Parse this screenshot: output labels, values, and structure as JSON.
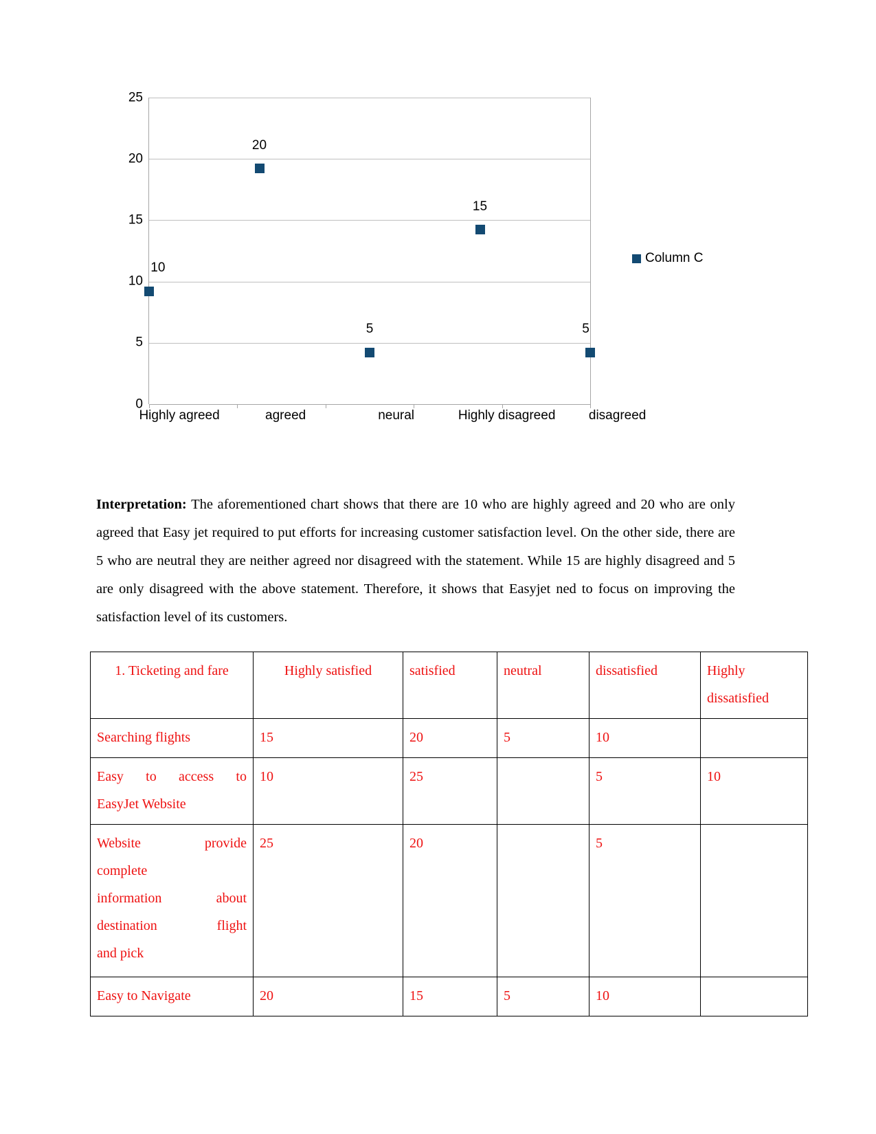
{
  "chart_data": {
    "type": "scatter",
    "title": "",
    "xlabel": "",
    "ylabel": "",
    "categories": [
      "Highly agreed",
      "agreed",
      "neural",
      "Highly disagreed",
      "disagreed"
    ],
    "values": [
      10,
      20,
      5,
      15,
      5
    ],
    "point_labels": [
      "10",
      "20",
      "5",
      "15",
      "5"
    ],
    "series": [
      {
        "name": "Column C",
        "values": [
          10,
          20,
          5,
          15,
          5
        ]
      }
    ],
    "legend": {
      "position": "right",
      "entries": [
        "Column C"
      ]
    },
    "ylim": [
      0,
      25
    ],
    "y_ticks": [
      "0",
      "5",
      "10",
      "15",
      "20",
      "25"
    ],
    "grid": true,
    "marker_color": "#134a72"
  },
  "interpretation": {
    "label": "Interpretation:",
    "body": " The aforementioned chart shows that there are  10 who are highly agreed and 20 who are only agreed that Easy jet required to put efforts for increasing customer satisfaction level. On the other side, there are 5 who are neutral they are neither  agreed nor disagreed with the statement. While 15 are highly disagreed and 5 are only disagreed with the above statement. Therefore, it shows that Easyjet ned to focus on improving the satisfaction level of its customers."
  },
  "table": {
    "header": {
      "number": "1.",
      "first": "Ticketing and fare",
      "columns": [
        "Highly satisfied",
        "satisfied",
        "neutral",
        "dissatisfied",
        "Highly dissatisfied"
      ]
    },
    "rows": [
      {
        "label": "Searching flights",
        "cells": [
          "15",
          "20",
          "5",
          "10",
          ""
        ]
      },
      {
        "label": "Easy to access to EasyJet Website",
        "label_line1": "Easy to access to",
        "label_line2": "EasyJet Website",
        "cells": [
          "10",
          "25",
          "",
          "5",
          "10"
        ]
      },
      {
        "label": "Website provide complete information about destination flight and pick",
        "label_line1": "Website provide",
        "label_line2": "complete",
        "label_line3": "information about",
        "label_line4": "destination flight",
        "label_line5": "and pick",
        "cells": [
          "25",
          "20",
          "",
          "5",
          ""
        ]
      },
      {
        "label": "Easy to Navigate",
        "cells": [
          "20",
          "15",
          "5",
          "10",
          ""
        ]
      }
    ]
  }
}
